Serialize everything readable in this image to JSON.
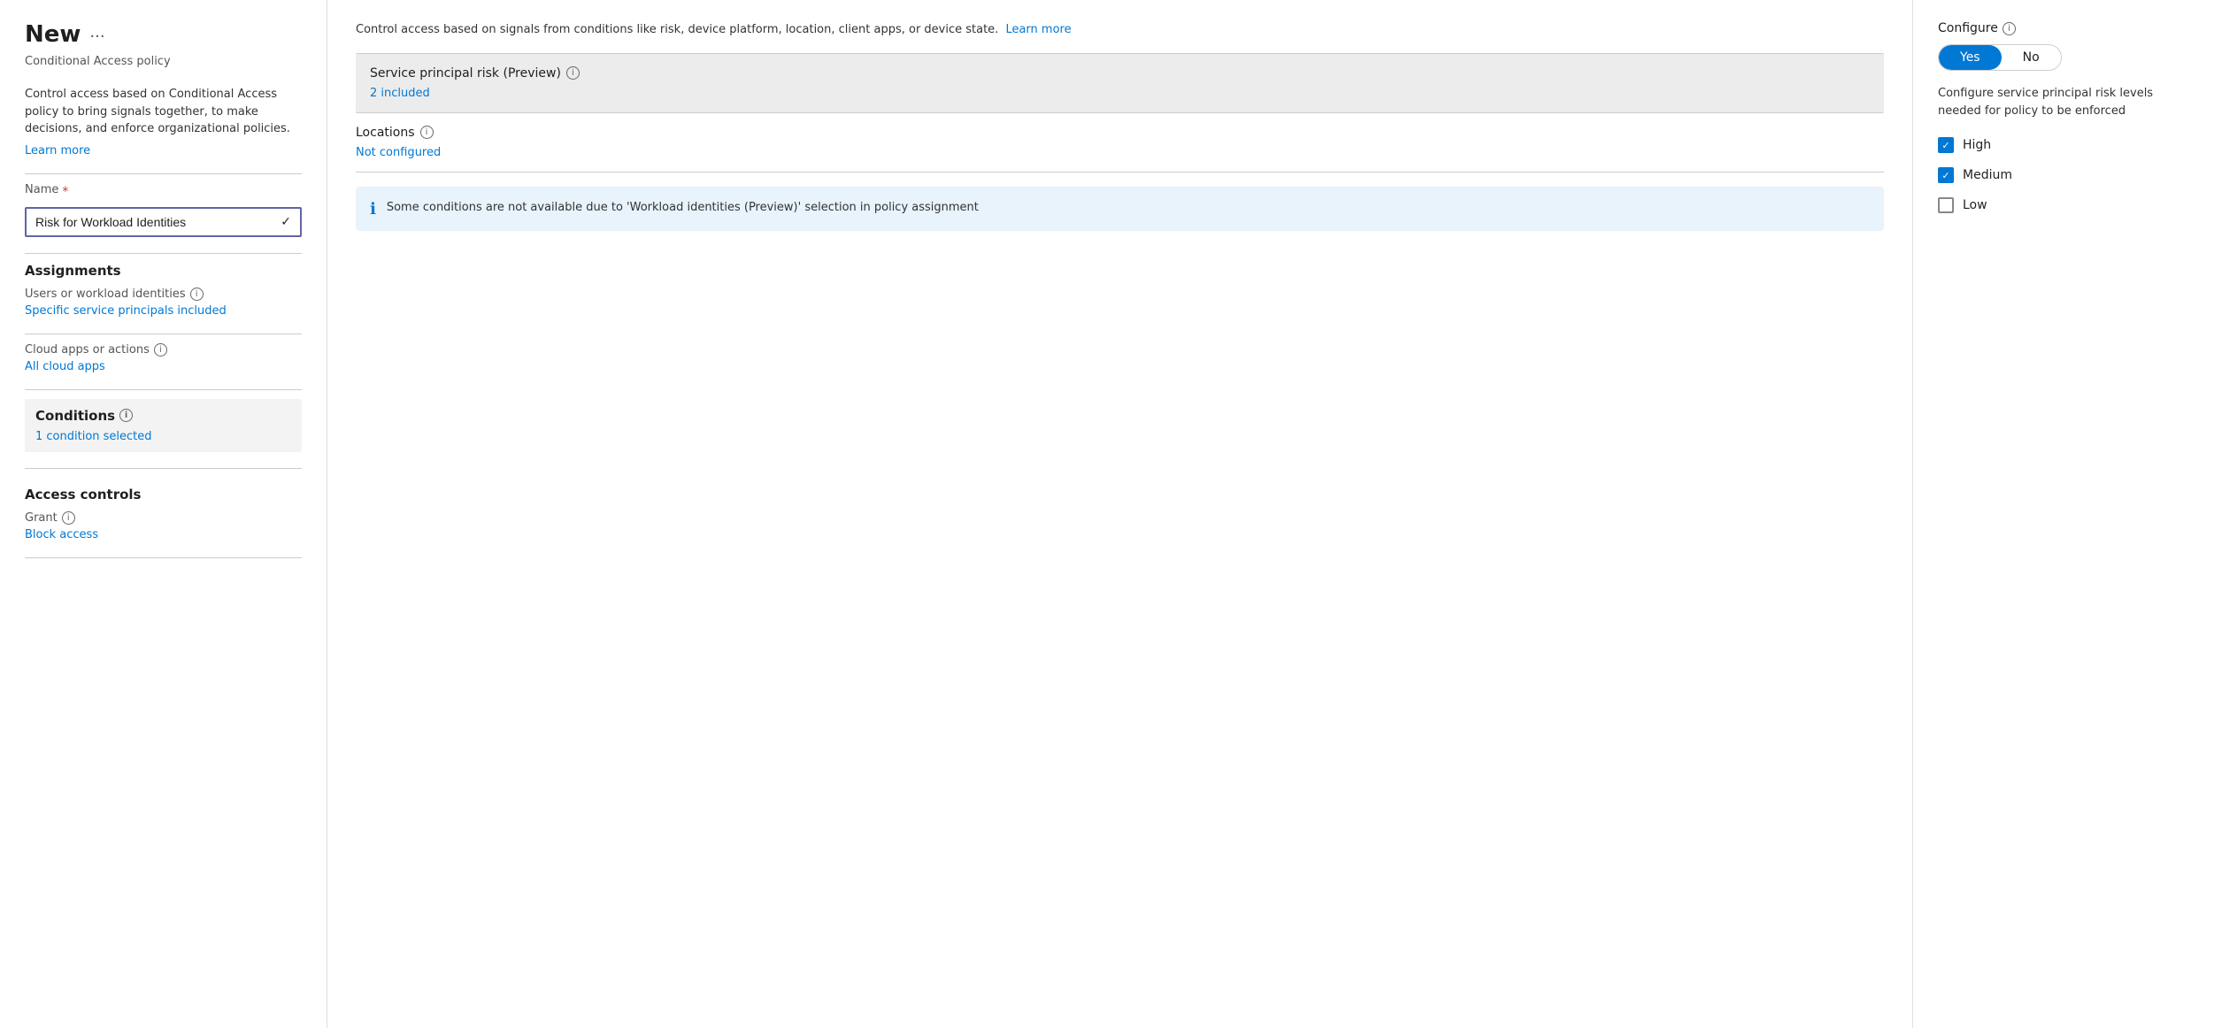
{
  "page": {
    "title": "New",
    "title_ellipsis": "···",
    "subtitle": "Conditional Access policy"
  },
  "left": {
    "description": "Control access based on Conditional Access policy to bring signals together, to make decisions, and enforce organizational policies.",
    "learn_more": "Learn more",
    "name_label": "Name",
    "name_required": "*",
    "name_value": "Risk for Workload Identities",
    "assignments_label": "Assignments",
    "users_label": "Users or workload identities",
    "users_value": "Specific service principals included",
    "cloud_apps_label": "Cloud apps or actions",
    "cloud_apps_value": "All cloud apps",
    "conditions_label": "Conditions",
    "conditions_value": "1 condition selected",
    "access_controls_label": "Access controls",
    "grant_label": "Grant",
    "grant_value": "Block access"
  },
  "middle": {
    "description": "Control access based on signals from conditions like risk, device platform, location, client apps, or device state.",
    "learn_more": "Learn more",
    "service_principal_risk_label": "Service principal risk (Preview)",
    "service_principal_risk_value": "2 included",
    "locations_label": "Locations",
    "locations_value": "Not configured",
    "info_box_text": "Some conditions are not available due to 'Workload identities (Preview)' selection in policy assignment"
  },
  "right": {
    "configure_label": "Configure",
    "toggle_yes": "Yes",
    "toggle_no": "No",
    "configure_description": "Configure service principal risk levels needed for policy to be enforced",
    "checkboxes": [
      {
        "label": "High",
        "checked": true
      },
      {
        "label": "Medium",
        "checked": true
      },
      {
        "label": "Low",
        "checked": false
      }
    ]
  }
}
